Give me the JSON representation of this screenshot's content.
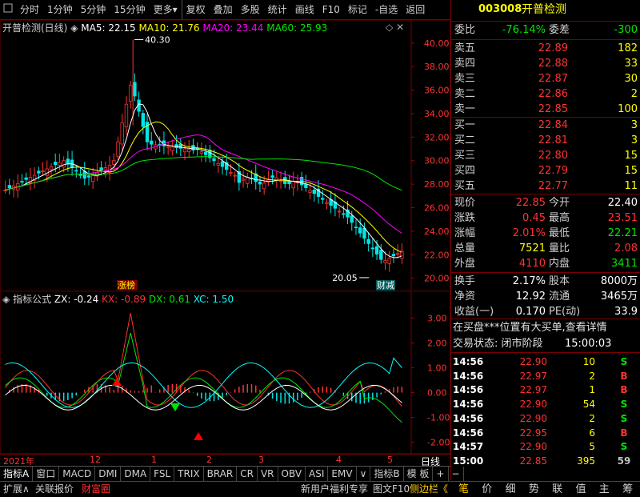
{
  "toolbar": {
    "items": [
      "分时",
      "1分钟",
      "5分钟",
      "15分钟",
      "更多",
      "复权",
      "叠加",
      "多股",
      "统计",
      "画线",
      "F10",
      "标记",
      "-自选",
      "返回"
    ]
  },
  "kchart": {
    "title": "开普检测(日线)",
    "ma": [
      {
        "label": "MA5: 22.15",
        "color": "#ffffff"
      },
      {
        "label": "MA10: 21.76",
        "color": "#ffff00"
      },
      {
        "label": "MA20: 23.44",
        "color": "#ff00ff"
      },
      {
        "label": "MA60: 25.93",
        "color": "#00e600"
      }
    ],
    "yticks": [
      "40.00",
      "38.00",
      "36.00",
      "34.00",
      "32.00",
      "30.00",
      "28.00",
      "26.00",
      "24.00",
      "22.00",
      "20.00"
    ],
    "high_label": "40.30",
    "low_label": "20.05",
    "tag1": "涨榜",
    "tag2": "财减"
  },
  "indicator": {
    "title": "指标公式",
    "zx": "ZX: -0.24",
    "kx": "KX: -0.89",
    "dx": "DX: 0.61",
    "xc": "XC: 1.50",
    "yticks": [
      "3.00",
      "2.00",
      "1.00",
      "0.00",
      "-1.00",
      "-2.00"
    ]
  },
  "timeaxis": {
    "labels": [
      "2021年",
      "12",
      "2",
      "1",
      "3",
      "4",
      "5"
    ],
    "period": "日线"
  },
  "tabs": [
    "指标A",
    "窗口",
    "MACD",
    "DMI",
    "DMA",
    "FSL",
    "TRIX",
    "BRAR",
    "CR",
    "VR",
    "OBV",
    "ASI",
    "EMV",
    "∨",
    "指标B",
    "模 板",
    "+",
    "−"
  ],
  "quote": {
    "code": "003008",
    "name": "开普检测",
    "webi_label": "委比",
    "webi_value": "-76.14%",
    "weicha_label": "委差",
    "weicha_value": "-300",
    "asks": [
      {
        "label": "卖五",
        "price": "22.89",
        "vol": "182"
      },
      {
        "label": "卖四",
        "price": "22.88",
        "vol": "33"
      },
      {
        "label": "卖三",
        "price": "22.87",
        "vol": "30"
      },
      {
        "label": "卖二",
        "price": "22.86",
        "vol": "2"
      },
      {
        "label": "卖一",
        "price": "22.85",
        "vol": "100"
      }
    ],
    "bids": [
      {
        "label": "买一",
        "price": "22.84",
        "vol": "3"
      },
      {
        "label": "买二",
        "price": "22.81",
        "vol": "3"
      },
      {
        "label": "买三",
        "price": "22.80",
        "vol": "15"
      },
      {
        "label": "买四",
        "price": "22.79",
        "vol": "15"
      },
      {
        "label": "买五",
        "price": "22.77",
        "vol": "11"
      }
    ],
    "stats": [
      {
        "l1": "现价",
        "v1": "22.85",
        "c1": "#ff3232",
        "l2": "今开",
        "v2": "22.40",
        "c2": "#ffffff"
      },
      {
        "l1": "涨跌",
        "v1": "0.45",
        "c1": "#ff3232",
        "l2": "最高",
        "v2": "23.51",
        "c2": "#ff3232"
      },
      {
        "l1": "涨幅",
        "v1": "2.01%",
        "c1": "#ff3232",
        "l2": "最低",
        "v2": "22.21",
        "c2": "#00e600"
      },
      {
        "l1": "总量",
        "v1": "7521",
        "c1": "#ffff00",
        "l2": "量比",
        "v2": "2.08",
        "c2": "#ff3232"
      },
      {
        "l1": "外盘",
        "v1": "4110",
        "c1": "#ff3232",
        "l2": "内盘",
        "v2": "3411",
        "c2": "#00e600"
      }
    ],
    "stats2": [
      {
        "l1": "换手",
        "v1": "2.17%",
        "l2": "股本",
        "v2": "8000万"
      },
      {
        "l1": "净资",
        "v1": "12.92",
        "l2": "流通",
        "v2": "3465万"
      },
      {
        "l1": "收益(一)",
        "v1": "0.170",
        "l2": "PE(动)",
        "v2": "33.9"
      }
    ],
    "notice": "在买盘***位置有大买单,查看详情",
    "status_label": "交易状态: 闭市阶段",
    "status_time": "15:00:03",
    "ticks": [
      {
        "t": "14:56",
        "p": "22.90",
        "v": "10",
        "d": "S"
      },
      {
        "t": "14:56",
        "p": "22.97",
        "v": "2",
        "d": "B"
      },
      {
        "t": "14:56",
        "p": "22.97",
        "v": "1",
        "d": "B"
      },
      {
        "t": "14:56",
        "p": "22.90",
        "v": "54",
        "d": "S"
      },
      {
        "t": "14:56",
        "p": "22.90",
        "v": "2",
        "d": "S"
      },
      {
        "t": "14:56",
        "p": "22.95",
        "v": "6",
        "d": "B"
      },
      {
        "t": "14:57",
        "p": "22.90",
        "v": "5",
        "d": "S"
      },
      {
        "t": "15:00",
        "p": "22.85",
        "v": "395",
        "d": "59"
      }
    ]
  },
  "bottom": {
    "left": [
      "扩展∧",
      "关联报价",
      "财富圈"
    ],
    "promo": "新用户福利专享",
    "f10": "图文F10",
    "side": "侧边栏《",
    "icons": [
      "笔",
      "价",
      "细",
      "势",
      "联",
      "值",
      "主",
      "筹"
    ]
  },
  "colors": {
    "up": "#ff3232",
    "down": "#00e600",
    "bg": "#000000",
    "border": "#7a0000"
  }
}
